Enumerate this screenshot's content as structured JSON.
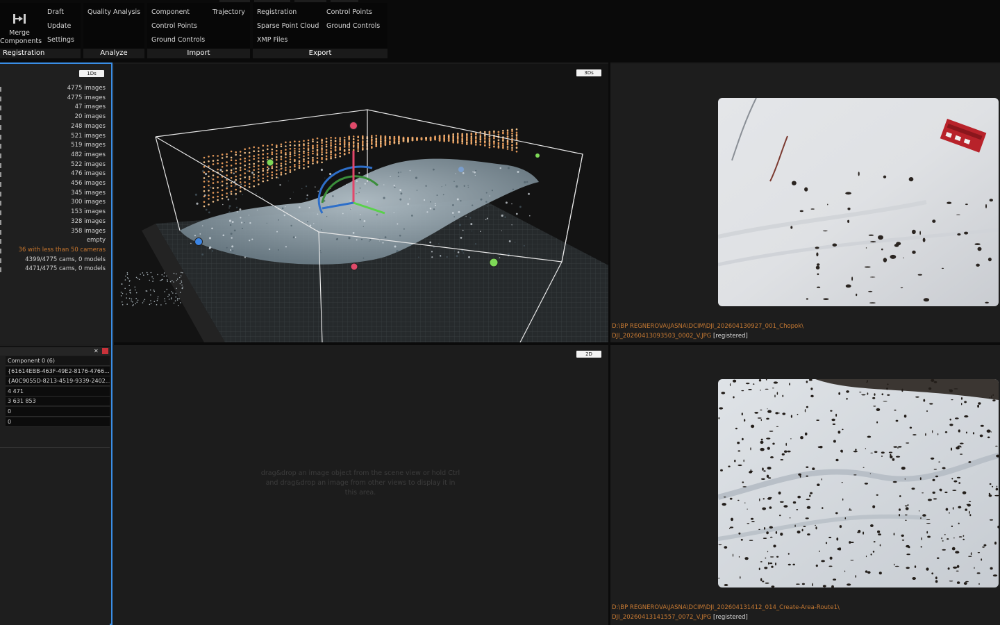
{
  "ribbon": {
    "merge": {
      "label_line1": "Merge",
      "label_line2": "Components",
      "icon": "merge-components-icon"
    },
    "registration": {
      "items": [
        "Draft",
        "Update",
        "Settings"
      ],
      "label": "Registration"
    },
    "analyze": {
      "items": [
        "Quality Analysis"
      ],
      "label": "Analyze"
    },
    "import": {
      "col1": [
        "Component",
        "Control Points",
        "Ground Controls"
      ],
      "col2": [
        "Trajectory"
      ],
      "label": "Import"
    },
    "export": {
      "col1": [
        "Registration",
        "Sparse Point Cloud",
        "XMP Files"
      ],
      "col2": [
        "Control Points",
        "Ground Controls"
      ],
      "label": "Export"
    }
  },
  "left_panel": {
    "view_badge": "1Ds",
    "stats": [
      "4775 images",
      "4775 images",
      "47 images",
      "20 images",
      "248 images",
      "521 images",
      "519 images",
      "482 images",
      "522 images",
      "476 images",
      "456 images",
      "345 images",
      "300 images",
      "153 images",
      "328 images",
      "358 images",
      "empty",
      "36 with less than 50 cameras",
      "4399/4775 cams, 0 models",
      "4471/4775 cams, 0 models"
    ],
    "component_rows": [
      "Component 0 (6)",
      "{61614EBB-463F-49E2-8176-4766...",
      "{A0C9055D-8213-4519-9339-2402...",
      "4 471",
      "3 631 853",
      "0",
      "0"
    ]
  },
  "view3d": {
    "badge": "3Ds"
  },
  "view2d": {
    "badge": "2D",
    "hint": "drag&drop an image object from the scene view or hold Ctrl and drag&drop an image from other views to display it in this area."
  },
  "photo1": {
    "path": "D:\\BP REGNEROVA\\JASNA\\DCIM\\DJI_202604130927_001_Chopok\\",
    "file": "DJI_20260413093503_0002_V.JPG",
    "status": "[registered]"
  },
  "photo2": {
    "path": "D:\\BP REGNEROVA\\JASNA\\DCIM\\DJI_202604131412_014_Create-Area-Route1\\",
    "file": "DJI_20260413141557_0072_V.JPG",
    "status": "[registered]"
  },
  "colors": {
    "accent": "#3a8ee6",
    "warning": "#c9772e",
    "path": "#c77a33",
    "cp_red": "#e04a6a",
    "cp_green": "#7ed957",
    "cp_blue": "#3c86e6"
  }
}
